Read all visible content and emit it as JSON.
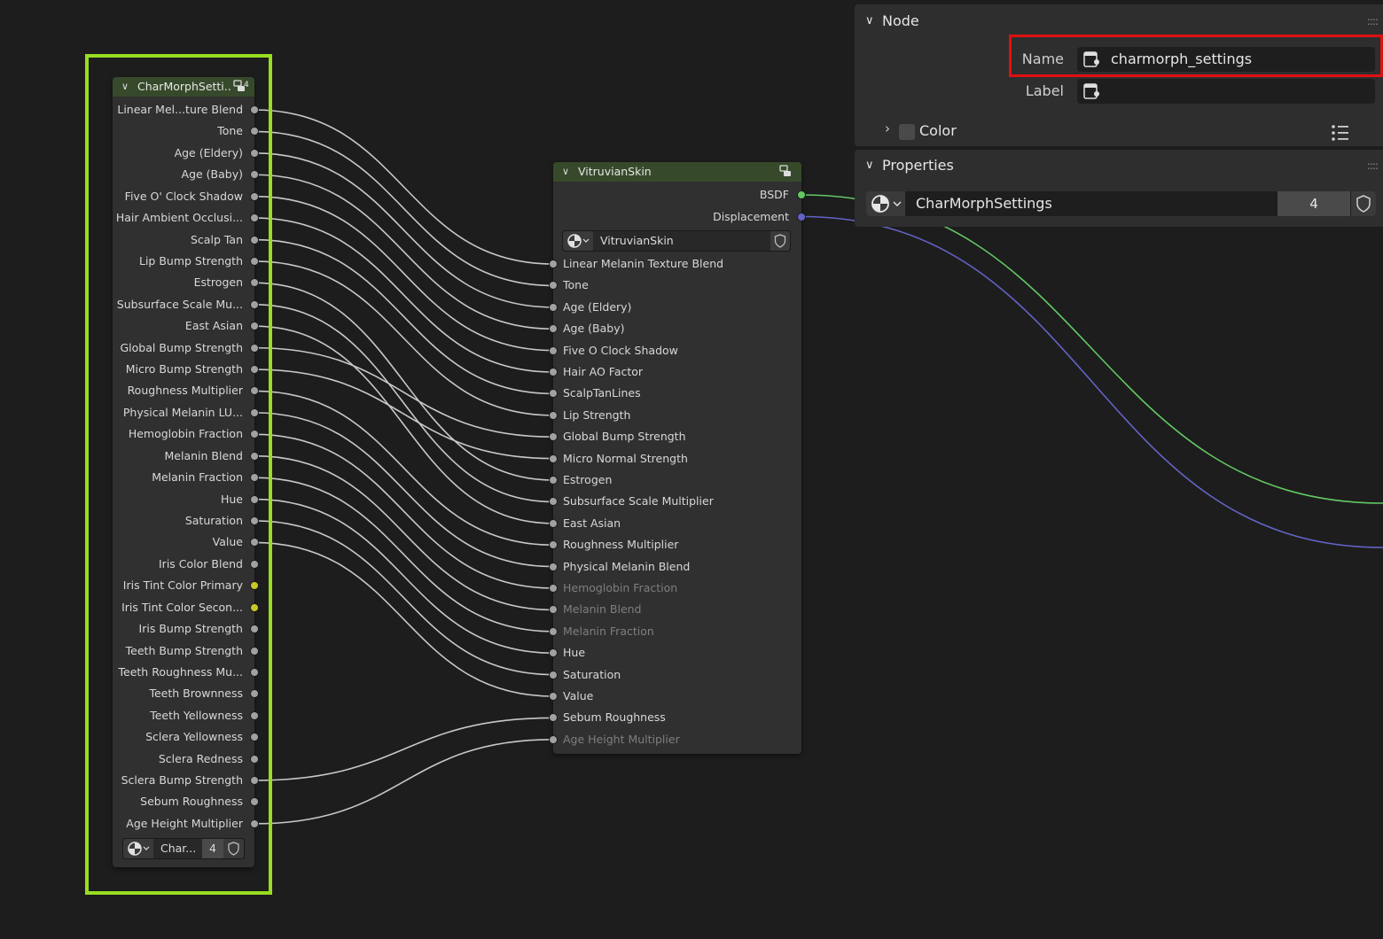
{
  "charmorph_node": {
    "title": "CharMorphSetti...",
    "user_count": "4",
    "outputs": [
      {
        "label": "Linear Mel...ture Blend"
      },
      {
        "label": "Tone"
      },
      {
        "label": "Age (Eldery)"
      },
      {
        "label": "Age (Baby)"
      },
      {
        "label": "Five O' Clock Shadow"
      },
      {
        "label": "Hair Ambient Occlusi..."
      },
      {
        "label": "Scalp Tan"
      },
      {
        "label": "Lip Bump Strength"
      },
      {
        "label": "Estrogen"
      },
      {
        "label": "Subsurface Scale Mu..."
      },
      {
        "label": "East Asian"
      },
      {
        "label": "Global Bump Strength"
      },
      {
        "label": "Micro Bump Strength"
      },
      {
        "label": "Roughness Multiplier"
      },
      {
        "label": "Physical Melanin LU..."
      },
      {
        "label": "Hemoglobin Fraction"
      },
      {
        "label": "Melanin Blend"
      },
      {
        "label": "Melanin Fraction"
      },
      {
        "label": "Hue"
      },
      {
        "label": "Saturation"
      },
      {
        "label": "Value"
      },
      {
        "label": "Iris Color Blend"
      },
      {
        "label": "Iris Tint Color Primary",
        "socket": "yellow"
      },
      {
        "label": "Iris Tint Color Secon...",
        "socket": "yellow"
      },
      {
        "label": "Iris Bump Strength"
      },
      {
        "label": "Teeth Bump Strength"
      },
      {
        "label": "Teeth Roughness Mu..."
      },
      {
        "label": "Teeth Brownness"
      },
      {
        "label": "Teeth Yellowness"
      },
      {
        "label": "Sclera Yellowness"
      },
      {
        "label": "Sclera Redness"
      },
      {
        "label": "Sclera Bump Strength"
      },
      {
        "label": "Sebum Roughness"
      },
      {
        "label": "Age Height Multiplier"
      }
    ],
    "group_selector": {
      "name": "Char...",
      "users": "4"
    }
  },
  "vitruvian_node": {
    "title": "VitruvianSkin",
    "outputs": [
      {
        "label": "BSDF",
        "socket": "green"
      },
      {
        "label": "Displacement",
        "socket": "purple"
      }
    ],
    "group_selector": {
      "name": "VitruvianSkin"
    },
    "inputs": [
      {
        "label": "Linear Melanin Texture Blend"
      },
      {
        "label": "Tone"
      },
      {
        "label": "Age (Eldery)"
      },
      {
        "label": "Age (Baby)"
      },
      {
        "label": "Five O Clock Shadow"
      },
      {
        "label": "Hair AO Factor"
      },
      {
        "label": "ScalpTanLines"
      },
      {
        "label": "Lip Strength"
      },
      {
        "label": "Global Bump Strength"
      },
      {
        "label": "Micro Normal Strength"
      },
      {
        "label": "Estrogen"
      },
      {
        "label": "Subsurface Scale Multiplier"
      },
      {
        "label": "East Asian"
      },
      {
        "label": "Roughness Multiplier"
      },
      {
        "label": "Physical Melanin Blend"
      },
      {
        "label": "Hemoglobin Fraction",
        "dim": true
      },
      {
        "label": "Melanin Blend",
        "dim": true
      },
      {
        "label": "Melanin Fraction",
        "dim": true
      },
      {
        "label": "Hue"
      },
      {
        "label": "Saturation"
      },
      {
        "label": "Value"
      },
      {
        "label": "Sebum Roughness"
      },
      {
        "label": "Age Height Multiplier",
        "dim": true
      }
    ]
  },
  "links": [
    [
      0,
      0
    ],
    [
      1,
      1
    ],
    [
      2,
      2
    ],
    [
      3,
      3
    ],
    [
      4,
      4
    ],
    [
      5,
      5
    ],
    [
      6,
      6
    ],
    [
      7,
      7
    ],
    [
      8,
      10
    ],
    [
      9,
      11
    ],
    [
      10,
      12
    ],
    [
      11,
      8
    ],
    [
      12,
      9
    ],
    [
      13,
      13
    ],
    [
      14,
      14
    ],
    [
      15,
      15
    ],
    [
      16,
      16
    ],
    [
      17,
      17
    ],
    [
      18,
      18
    ],
    [
      19,
      19
    ],
    [
      20,
      20
    ],
    [
      31,
      21
    ],
    [
      33,
      22
    ]
  ],
  "sidebar": {
    "node_panel": {
      "title": "Node",
      "name_label": "Name",
      "name_value": "charmorph_settings",
      "label_label": "Label",
      "label_value": "",
      "color_label": "Color"
    },
    "properties_panel": {
      "title": "Properties",
      "group_name": "CharMorphSettings",
      "group_users": "4"
    }
  },
  "colors": {
    "selection": "#99dd22",
    "highlight": "#e01010",
    "wire": "#c8c8c8",
    "bsdf_wire": "#63c763",
    "displacement_wire": "#6363c7",
    "node_header": "#364a2b"
  }
}
